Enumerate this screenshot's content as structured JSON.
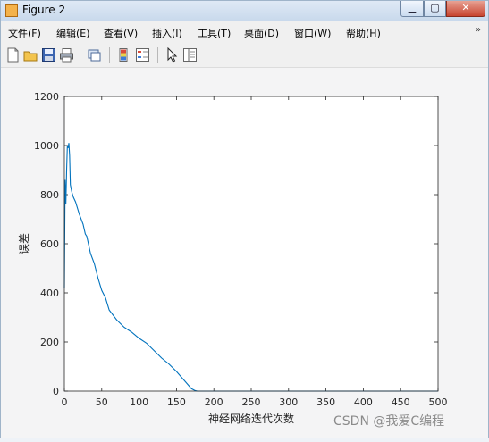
{
  "window": {
    "title": "Figure 2",
    "buttons": {
      "min": "▁",
      "max": "▢",
      "close": "✕"
    }
  },
  "menubar": {
    "items": [
      "文件(F)",
      "编辑(E)",
      "查看(V)",
      "插入(I)",
      "工具(T)",
      "桌面(D)",
      "窗口(W)",
      "帮助(H)"
    ],
    "overflow_icon": "chevron-right-icon"
  },
  "toolbar": {
    "icons": [
      "new-figure-icon",
      "open-file-icon",
      "save-icon",
      "print-icon",
      "link-plot-icon",
      "colorbar-icon",
      "legend-icon",
      "select-cursor-icon",
      "property-editor-icon"
    ]
  },
  "watermark": "CSDN @我爱C编程",
  "chart_data": {
    "type": "line",
    "title": "",
    "xlabel": "神经网络迭代次数",
    "ylabel": "误差",
    "xlim": [
      0,
      500
    ],
    "ylim": [
      0,
      1200
    ],
    "xticks": [
      "0",
      "50",
      "100",
      "150",
      "200",
      "250",
      "300",
      "350",
      "400",
      "450",
      "500"
    ],
    "yticks": [
      "0",
      "200",
      "400",
      "600",
      "800",
      "1000",
      "1200"
    ],
    "grid": false,
    "line_color": "#0072BD",
    "series": [
      {
        "x": [
          0,
          1,
          2,
          3,
          4,
          5,
          6,
          7,
          8,
          10,
          12,
          15,
          20,
          25,
          28,
          30,
          35,
          40,
          45,
          50,
          55,
          60,
          65,
          70,
          80,
          90,
          100,
          110,
          120,
          130,
          140,
          150,
          160,
          170,
          175,
          178,
          180,
          200,
          250,
          300,
          350,
          400,
          450,
          500
        ],
        "y": [
          420,
          860,
          760,
          900,
          1000,
          990,
          1010,
          960,
          840,
          810,
          790,
          770,
          720,
          680,
          640,
          630,
          560,
          520,
          460,
          410,
          380,
          330,
          310,
          290,
          260,
          240,
          215,
          195,
          165,
          135,
          110,
          80,
          45,
          10,
          2,
          0,
          0,
          0,
          0,
          0,
          0,
          0,
          0,
          0
        ]
      }
    ]
  }
}
